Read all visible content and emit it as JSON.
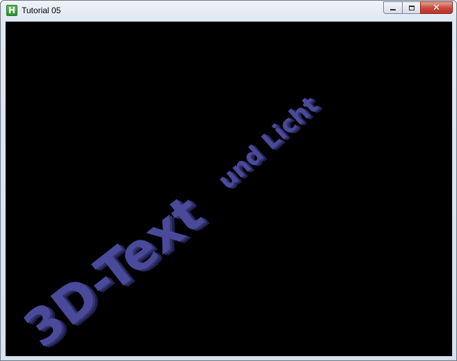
{
  "window": {
    "title": "Tutorial 05",
    "icon": "app-icon-h",
    "icon_letter": "H",
    "controls": {
      "minimize": "minimize-icon",
      "maximize": "maximize-icon",
      "close": "close-icon",
      "close_glyph": "✕"
    }
  },
  "scene": {
    "main_text": "3D-Text",
    "sub_text": "und Licht",
    "text_color": "#4a4a9a",
    "text_shadow_color": "#1f1f4f",
    "background": "#000000"
  }
}
